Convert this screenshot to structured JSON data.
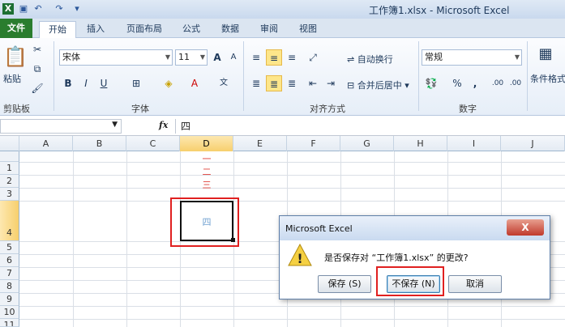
{
  "window": {
    "title": "工作簿1.xlsx - Microsoft Excel"
  },
  "quick_access": {
    "undo_icon": "undo-icon",
    "redo_icon": "redo-icon"
  },
  "tabs": [
    {
      "label": "文件"
    },
    {
      "label": "开始"
    },
    {
      "label": "插入"
    },
    {
      "label": "页面布局"
    },
    {
      "label": "公式"
    },
    {
      "label": "数据"
    },
    {
      "label": "审阅"
    },
    {
      "label": "视图"
    }
  ],
  "ribbon": {
    "clipboard": {
      "paste": "粘贴",
      "label": "剪贴板"
    },
    "font": {
      "name": "宋体",
      "size": "11",
      "bold": "B",
      "italic": "I",
      "underline": "U",
      "grow": "A",
      "shrink": "A",
      "label": "字体"
    },
    "alignment": {
      "wrap": "自动换行",
      "merge": "合并后居中",
      "label": "对齐方式"
    },
    "number": {
      "format": "常规",
      "percent": "%",
      "comma": ",",
      "inc_dec": ".00",
      "dec_dec": ".00",
      "label": "数字"
    },
    "styles": {
      "cond": "条件格式"
    }
  },
  "formula_bar": {
    "fx": "fx",
    "content": "四"
  },
  "grid": {
    "columns": [
      "A",
      "B",
      "C",
      "D",
      "E",
      "F",
      "G",
      "H",
      "I",
      "J"
    ],
    "selected_column": "D",
    "rows": [
      "1",
      "2",
      "3",
      "4",
      "5",
      "6",
      "7",
      "8",
      "9",
      "10",
      "11"
    ],
    "selected_row": "4",
    "cells": {
      "D1": "一",
      "D2": "二",
      "D3": "三",
      "D4": "四"
    }
  },
  "dialog": {
    "title": "Microsoft Excel",
    "message": "是否保存对 “工作簿1.xlsx” 的更改?",
    "buttons": {
      "save": "保存 (S)",
      "dont_save": "不保存 (N)",
      "cancel": "取消"
    },
    "close": "X"
  },
  "colors": {
    "highlight": "#e02020",
    "file_tab": "#2a7d2e",
    "cell_text": "#e0403a"
  }
}
